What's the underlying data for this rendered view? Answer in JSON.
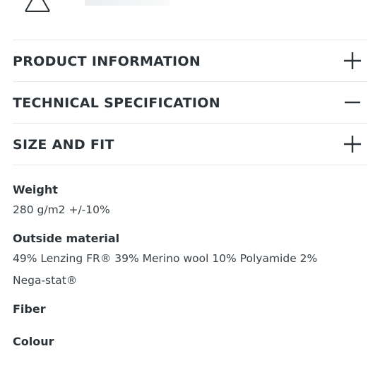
{
  "accordion": {
    "items": [
      {
        "title": "PRODUCT INFORMATION",
        "state": "collapsed",
        "toggle_icon": "plus-icon"
      },
      {
        "title": "TECHNICAL SPECIFICATION",
        "state": "expanded",
        "toggle_icon": "minus-icon"
      },
      {
        "title": "SIZE AND FIT",
        "state": "collapsed",
        "toggle_icon": "plus-icon"
      }
    ]
  },
  "specs": {
    "weight": {
      "label": "Weight",
      "value": "280 g/m2 +/-10%"
    },
    "outside_material": {
      "label": "Outside material",
      "value_line1": "49% Lenzing FR® 39% Merino wool 10% Polyamide 2%",
      "value_line2": "Nega-stat®"
    },
    "fiber": {
      "label": "Fiber"
    },
    "colour": {
      "label": "Colour"
    }
  },
  "colors": {
    "text": "#2b3338",
    "divider": "#e4e7e9",
    "background": "#ffffff"
  },
  "icons": {
    "top": "warning-triangle-icon"
  }
}
